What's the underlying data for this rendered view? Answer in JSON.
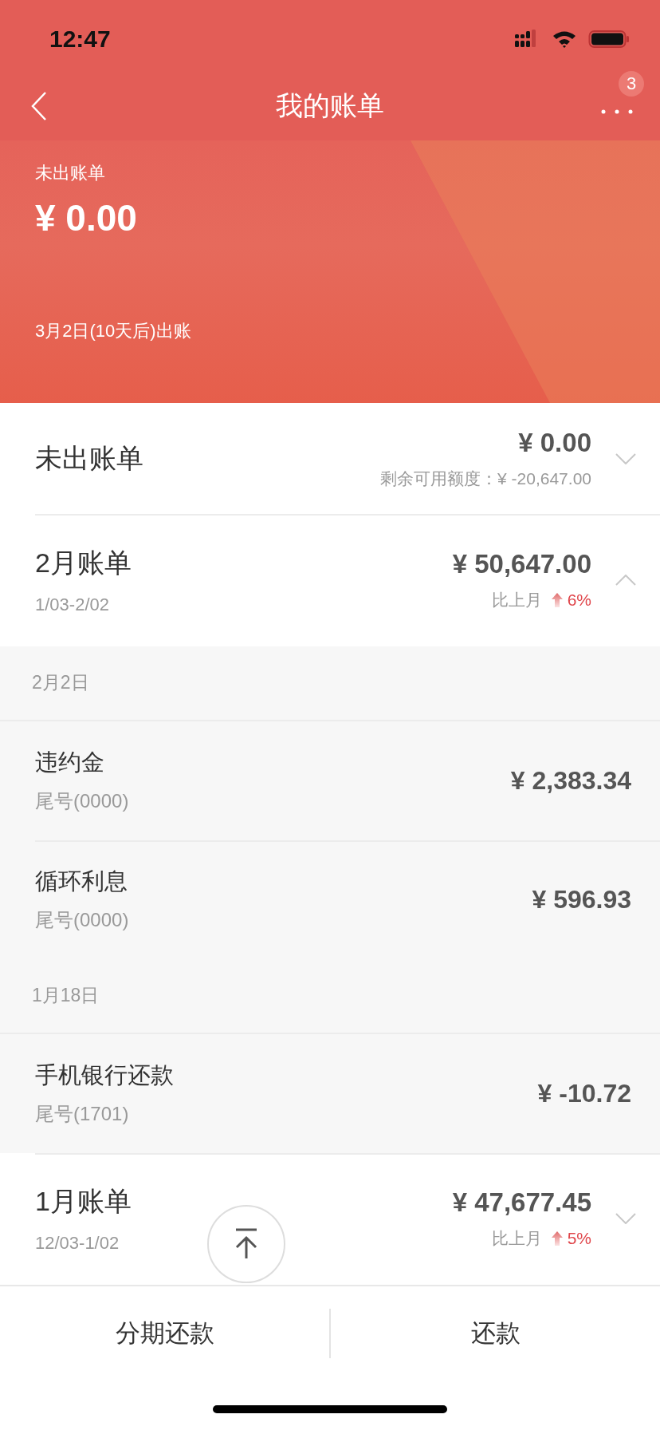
{
  "status_bar": {
    "time": "12:47"
  },
  "nav": {
    "title": "我的账单",
    "badge": "3"
  },
  "hero": {
    "label": "未出账单",
    "amount": "¥ 0.00",
    "due": "3月2日(10天后)出账"
  },
  "bills": [
    {
      "title": "未出账单",
      "amount": "¥ 0.00",
      "note": "剩余可用额度：¥ -20,647.00",
      "expanded": false
    },
    {
      "title": "2月账单",
      "period": "1/03-2/02",
      "amount": "¥ 50,647.00",
      "compare_label": "比上月",
      "change": "6%",
      "change_up": true,
      "expanded": true,
      "groups": [
        {
          "date": "2月2日",
          "items": [
            {
              "name": "违约金",
              "card": "尾号(0000)",
              "amount": "¥ 2,383.34"
            },
            {
              "name": "循环利息",
              "card": "尾号(0000)",
              "amount": "¥ 596.93"
            }
          ]
        },
        {
          "date": "1月18日",
          "items": [
            {
              "name": "手机银行还款",
              "card": "尾号(1701)",
              "amount": "¥ -10.72"
            }
          ]
        }
      ]
    },
    {
      "title": "1月账单",
      "period": "12/03-1/02",
      "amount": "¥ 47,677.45",
      "compare_label": "比上月",
      "change": "5%",
      "change_up": true,
      "expanded": false
    }
  ],
  "actions": [
    {
      "label": "分期还款"
    },
    {
      "label": "还款"
    }
  ]
}
